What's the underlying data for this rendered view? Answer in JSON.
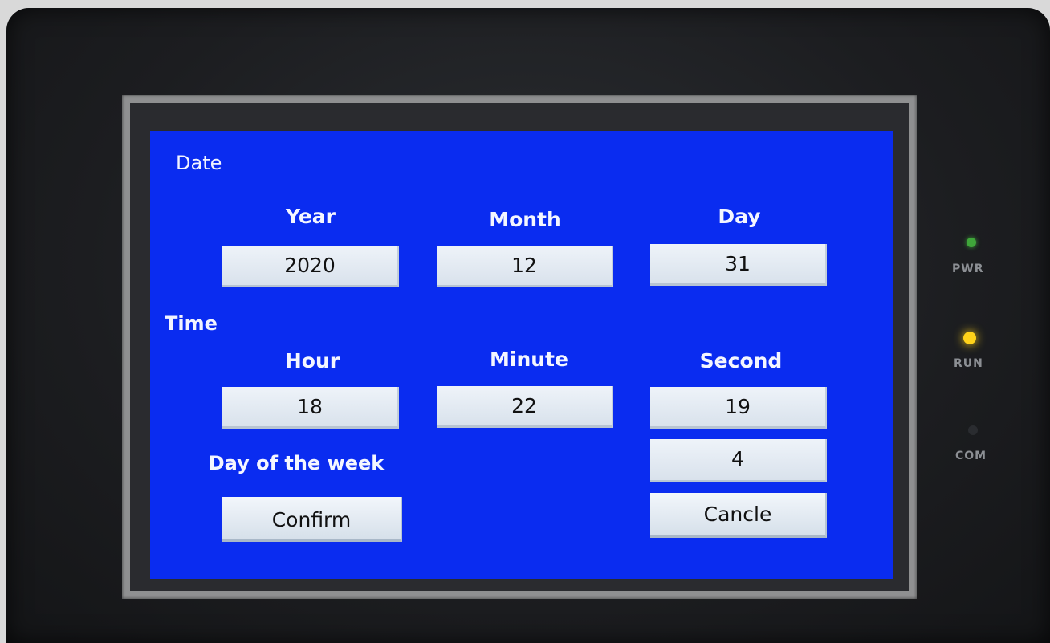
{
  "date_section": {
    "title": "Date",
    "year": {
      "label": "Year",
      "value": "2020"
    },
    "month": {
      "label": "Month",
      "value": "12"
    },
    "day": {
      "label": "Day",
      "value": "31"
    }
  },
  "time_section": {
    "title": "Time",
    "hour": {
      "label": "Hour",
      "value": "18"
    },
    "minute": {
      "label": "Minute",
      "value": "22"
    },
    "second": {
      "label": "Second",
      "value": "19"
    }
  },
  "weekday": {
    "label": "Day of the week",
    "value": "4"
  },
  "buttons": {
    "confirm": "Confirm",
    "cancel": "Cancle"
  },
  "indicators": [
    {
      "label": "PWR",
      "color": "#3fa63a"
    },
    {
      "label": "RUN",
      "color": "#ffd21a"
    },
    {
      "label": "COM",
      "color": "#2a2c30"
    }
  ]
}
